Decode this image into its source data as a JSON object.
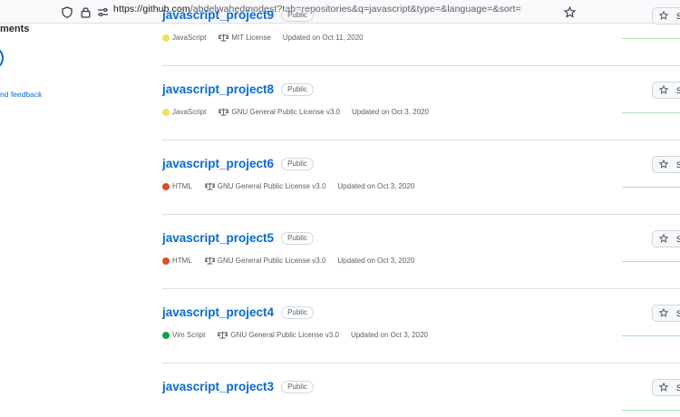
{
  "browser": {
    "url_host": "https://github.com",
    "url_path": "/abdelwahedmodest?tab=repositories&q=javascript&type=&language=&sort="
  },
  "sidebar": {
    "heading": "ments",
    "feedback_link": "nd feedback"
  },
  "repos": [
    {
      "name": "javascript_project9",
      "visibility": "Public",
      "language": "JavaScript",
      "language_color": "#f1e05a",
      "license": "MIT License",
      "updated": "Updated on Oct 11, 2020",
      "star_label": "S"
    },
    {
      "name": "javascript_project8",
      "visibility": "Public",
      "language": "JavaScript",
      "language_color": "#f1e05a",
      "license": "GNU General Public License v3.0",
      "updated": "Updated on Oct 3, 2020",
      "star_label": "S"
    },
    {
      "name": "javascript_project6",
      "visibility": "Public",
      "language": "HTML",
      "language_color": "#e34c26",
      "license": "GNU General Public License v3.0",
      "updated": "Updated on Oct 3, 2020",
      "star_label": "S"
    },
    {
      "name": "javascript_project5",
      "visibility": "Public",
      "language": "HTML",
      "language_color": "#e34c26",
      "license": "GNU General Public License v3.0",
      "updated": "Updated on Oct 3, 2020",
      "star_label": "S"
    },
    {
      "name": "javascript_project4",
      "visibility": "Public",
      "language": "Vim Script",
      "language_color": "#199f4b",
      "license": "GNU General Public License v3.0",
      "updated": "Updated on Oct 3, 2020",
      "star_label": "S"
    },
    {
      "name": "javascript_project3",
      "visibility": "Public",
      "language": "",
      "language_color": "",
      "license": "",
      "updated": "",
      "star_label": "S"
    }
  ]
}
